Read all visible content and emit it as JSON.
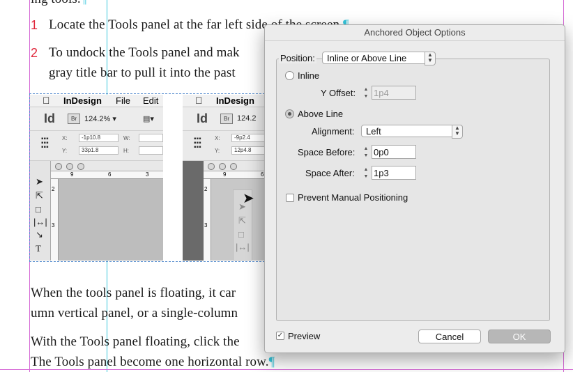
{
  "document": {
    "top_fragment": "ing tools.",
    "pilcrow": "¶",
    "list": [
      {
        "num": "1",
        "line1": "Locate the Tools panel at the far left side of the screen."
      },
      {
        "num": "2",
        "line1": "To undock the Tools panel and mak",
        "line2": "gray title bar to pull it into the past"
      }
    ],
    "para_a_line1": "When the tools panel is floating, it car",
    "para_a_line2": "umn vertical panel, or a single-column",
    "para_b_line1": "With the Tools panel floating, click the",
    "para_b_line2": "The Tools panel become one horizontal row."
  },
  "screenshots": [
    {
      "menu": {
        "app": "InDesign",
        "file": "File",
        "edit": "Edit"
      },
      "logo": "Id",
      "br": "Br",
      "zoom": "124.2%",
      "x_label": "X:",
      "x_value": "-1p10.8",
      "y_label": "Y:",
      "y_value": "33p1.8",
      "w_label": "W:",
      "h_label": "H:",
      "ruler_h": [
        "9",
        "6",
        "3"
      ],
      "ruler_v": [
        "2",
        "3"
      ]
    },
    {
      "menu": {
        "app": "InDesign"
      },
      "logo": "Id",
      "br": "Br",
      "zoom": "124.2",
      "x_label": "X:",
      "x_value": "-9p2.4",
      "y_label": "Y:",
      "y_value": "12p4.8",
      "ruler_h": [
        "9",
        "6"
      ],
      "ruler_v": [
        "2",
        "3"
      ]
    }
  ],
  "dialog": {
    "title": "Anchored Object Options",
    "position_label": "Position:",
    "position_value": "Inline or Above Line",
    "inline_label": "Inline",
    "inline_selected": false,
    "y_offset_label": "Y Offset:",
    "y_offset_value": "1p4",
    "above_line_label": "Above Line",
    "above_line_selected": true,
    "alignment_label": "Alignment:",
    "alignment_value": "Left",
    "space_before_label": "Space Before:",
    "space_before_value": "0p0",
    "space_after_label": "Space After:",
    "space_after_value": "1p3",
    "prevent_label": "Prevent Manual Positioning",
    "prevent_checked": false,
    "preview_label": "Preview",
    "preview_checked": true,
    "cancel_label": "Cancel",
    "ok_label": "OK"
  },
  "colors": {
    "guide_cyan": "#37c6dc",
    "margin_magenta": "#d66ad6",
    "list_number_red": "#e0283c",
    "ok_button": "#b7b7b7"
  },
  "icons": [
    "apple-icon",
    "selection-tool-icon",
    "direct-selection-tool-icon",
    "page-tool-icon",
    "gap-tool-icon",
    "type-tool-icon",
    "mouse-cursor-icon",
    "checkmark-icon"
  ]
}
